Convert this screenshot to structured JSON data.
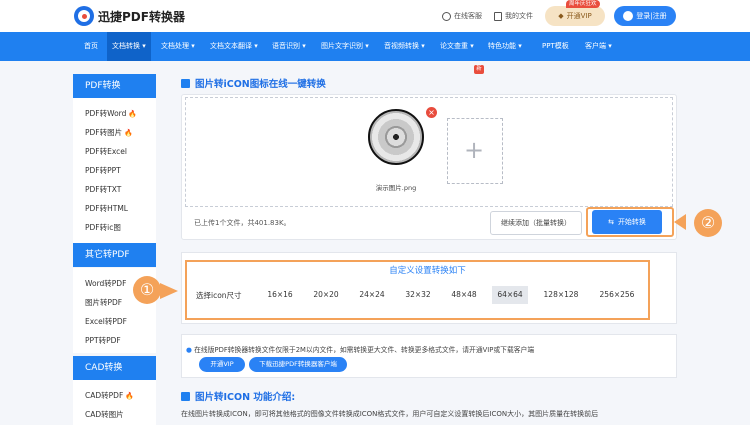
{
  "header": {
    "logo_text": "迅捷PDF转换器",
    "service_label": "在线客服",
    "my_files_label": "我的文件",
    "vip_badge": "周年庆狂欢",
    "vip_label": "开通VIP",
    "login_label": "登录|注册"
  },
  "nav": {
    "items": [
      "首页",
      "文档转换",
      "文档处理",
      "文档文本翻译",
      "语音识别",
      "图片文字识别",
      "音视频转换",
      "论文查重",
      "特色功能",
      "PPT模板",
      "客户端"
    ],
    "hot_badge": "新"
  },
  "sidebar": {
    "groups": [
      {
        "title": "PDF转换",
        "items": [
          "PDF转Word",
          "PDF转图片",
          "PDF转Excel",
          "PDF转PPT",
          "PDF转TXT",
          "PDF转HTML",
          "PDF转ic图"
        ]
      },
      {
        "title": "其它转PDF",
        "items": [
          "Word转PDF",
          "图片转PDF",
          "Excel转PDF",
          "PPT转PDF"
        ]
      },
      {
        "title": "CAD转换",
        "items": [
          "CAD转PDF",
          "CAD转图片"
        ]
      }
    ]
  },
  "main": {
    "title": "图片转iCON图标在线一键转换",
    "file_name": "演示图片.png",
    "upload_status": "已上传1个文件，共401.83K。",
    "continue_label": "继续添加（批量转换）",
    "start_label": "开始转换",
    "marker_1": "①",
    "marker_2": "②",
    "settings_title": "自定义设置转换如下",
    "size_label": "选择icon尺寸",
    "sizes": [
      "16×16",
      "20×20",
      "24×24",
      "32×32",
      "48×48",
      "64×64",
      "128×128",
      "256×256"
    ],
    "selected_size": "64×64",
    "notice": "在线版PDF转换器转换文件仅限于2M以内文件，如需转换更大文件、转换更多格式文件，请开通VIP或下载客户端",
    "vip_button": "开通VIP",
    "download_button": "下载迅捷PDF转换器客户端",
    "intro_title": "图片转ICON 功能介绍:",
    "intro_text": "在线图片转换成ICON，即可将其他格式的图像文件转换成ICON格式文件，用户可自定义设置转换后ICON大小，其图片质量在转换前后"
  },
  "colors": {
    "accent": "#1f80f0",
    "highlight": "#f4a259",
    "vip": "#f6e3c4",
    "close": "#e84c3d"
  }
}
